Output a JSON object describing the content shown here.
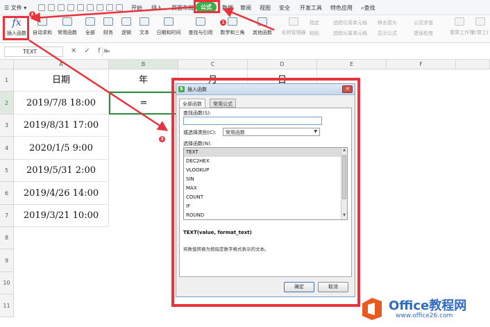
{
  "menubar": {
    "file_label": "文件",
    "tabs": [
      "开始",
      "插入",
      "页面布局",
      "公式",
      "数据",
      "审阅",
      "视图",
      "安全",
      "开发工具",
      "特色应用"
    ],
    "active_tab": "公式",
    "search_label": "查找"
  },
  "ribbon": {
    "insert_function": "插入函数",
    "buttons": [
      "自动求和",
      "常用函数",
      "全部",
      "财务",
      "逻辑",
      "文本",
      "日期和时间",
      "查找与引用",
      "数学和三角",
      "其他函数"
    ],
    "disabled_buttons": [
      "名称管理器",
      "追踪引用单元格",
      "移去箭头",
      "显示公式",
      "重算工作簿",
      "计算工作表"
    ],
    "small_items": [
      "指定",
      "粘贴",
      "追踪从属单元格",
      "错误检查",
      "公式求值"
    ]
  },
  "formula_bar": {
    "name_box": "TEXT",
    "icons": "✕ ✓ fx",
    "content": "="
  },
  "sheet": {
    "columns": [
      "A",
      "B",
      "C",
      "D",
      "E",
      "F"
    ],
    "rows": [
      "1",
      "2",
      "3",
      "4",
      "5",
      "6",
      "7",
      "8",
      "9",
      "10",
      "11"
    ],
    "header_row": [
      "日期",
      "年",
      "月",
      "日"
    ],
    "dates": [
      "2019/7/8  18:00",
      "2019/8/31  17:00",
      "2020/1/5  9:00",
      "2019/5/31  2:00",
      "2019/4/26  14:00",
      "2019/3/21  10:00"
    ],
    "active_cell_value": "="
  },
  "dialog": {
    "title": "插入函数",
    "tabs": [
      "全部函数",
      "常用公式"
    ],
    "search_label": "查找函数(S):",
    "category_label": "或选择类别(C):",
    "category_value": "常用函数",
    "select_label": "选择函数(N):",
    "functions": [
      "TEXT",
      "DEC2HEX",
      "VLOOKUP",
      "SIN",
      "MAX",
      "COUNT",
      "IF",
      "ROUND"
    ],
    "selected_function": "TEXT",
    "signature": "TEXT(value, format_text)",
    "description": "将数值转换为按指定数字格式表示的文本。",
    "ok_label": "确定",
    "cancel_label": "取消"
  },
  "annotations": [
    "1",
    "2",
    "3"
  ],
  "watermark": {
    "brand": "Office教程网",
    "url": "www.office26.com"
  },
  "colors": {
    "accent_green": "#3fae49",
    "annotation_red": "#e8323c",
    "brand_blue": "#2f6bc2"
  }
}
